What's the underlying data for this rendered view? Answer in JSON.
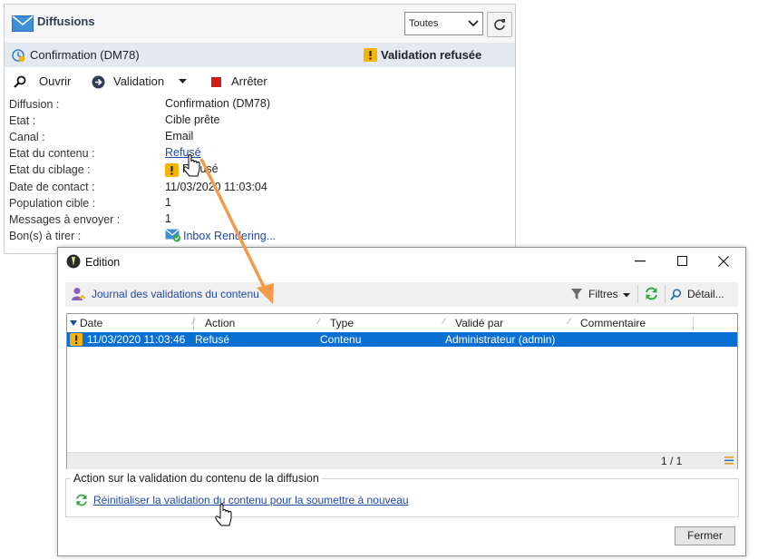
{
  "panel": {
    "title": "Diffusions",
    "filter_select": "Toutes",
    "delivery_header": "Confirmation (DM78)",
    "validation_status": "Validation refusée",
    "toolbar": {
      "open": "Ouvrir",
      "validation": "Validation",
      "stop": "Arrêter"
    },
    "fields": [
      {
        "label": "Diffusion :",
        "value": "Confirmation (DM78)"
      },
      {
        "label": "Etat :",
        "value": "Cible prête"
      },
      {
        "label": "Canal :",
        "value": "Email"
      },
      {
        "label": "Etat du contenu :",
        "value": "Refusé"
      },
      {
        "label": "Etat du ciblage :",
        "value": "Refusé"
      },
      {
        "label": "Date de contact :",
        "value": "11/03/2020 11:03:04"
      },
      {
        "label": "Population cible :",
        "value": "1"
      },
      {
        "label": "Messages à envoyer :",
        "value": "1"
      },
      {
        "label": "Bon(s) à tirer :",
        "value": "Inbox Rendering..."
      }
    ]
  },
  "dialog": {
    "title": "Edition",
    "journal_link": "Journal des validations du contenu",
    "filters": "Filtres",
    "detail": "Détail...",
    "columns": [
      "Date",
      "Action",
      "Type",
      "Validé par",
      "Commentaire"
    ],
    "rows": [
      {
        "date": "11/03/2020 11:03:46",
        "action": "Refusé",
        "type": "Contenu",
        "validated_by": "Administrateur (admin)",
        "comment": ""
      }
    ],
    "pagination": "1 / 1",
    "group_title": "Action sur la validation du contenu de la diffusion",
    "reset_link": "Réinitialiser la validation du contenu pour la soumettre à nouveau",
    "close_button": "Fermer"
  },
  "colors": {
    "accent_blue": "#0a6fd2",
    "link": "#1f4aa8",
    "warning": "#f4b400",
    "annotation_arrow": "#f39a4b"
  }
}
